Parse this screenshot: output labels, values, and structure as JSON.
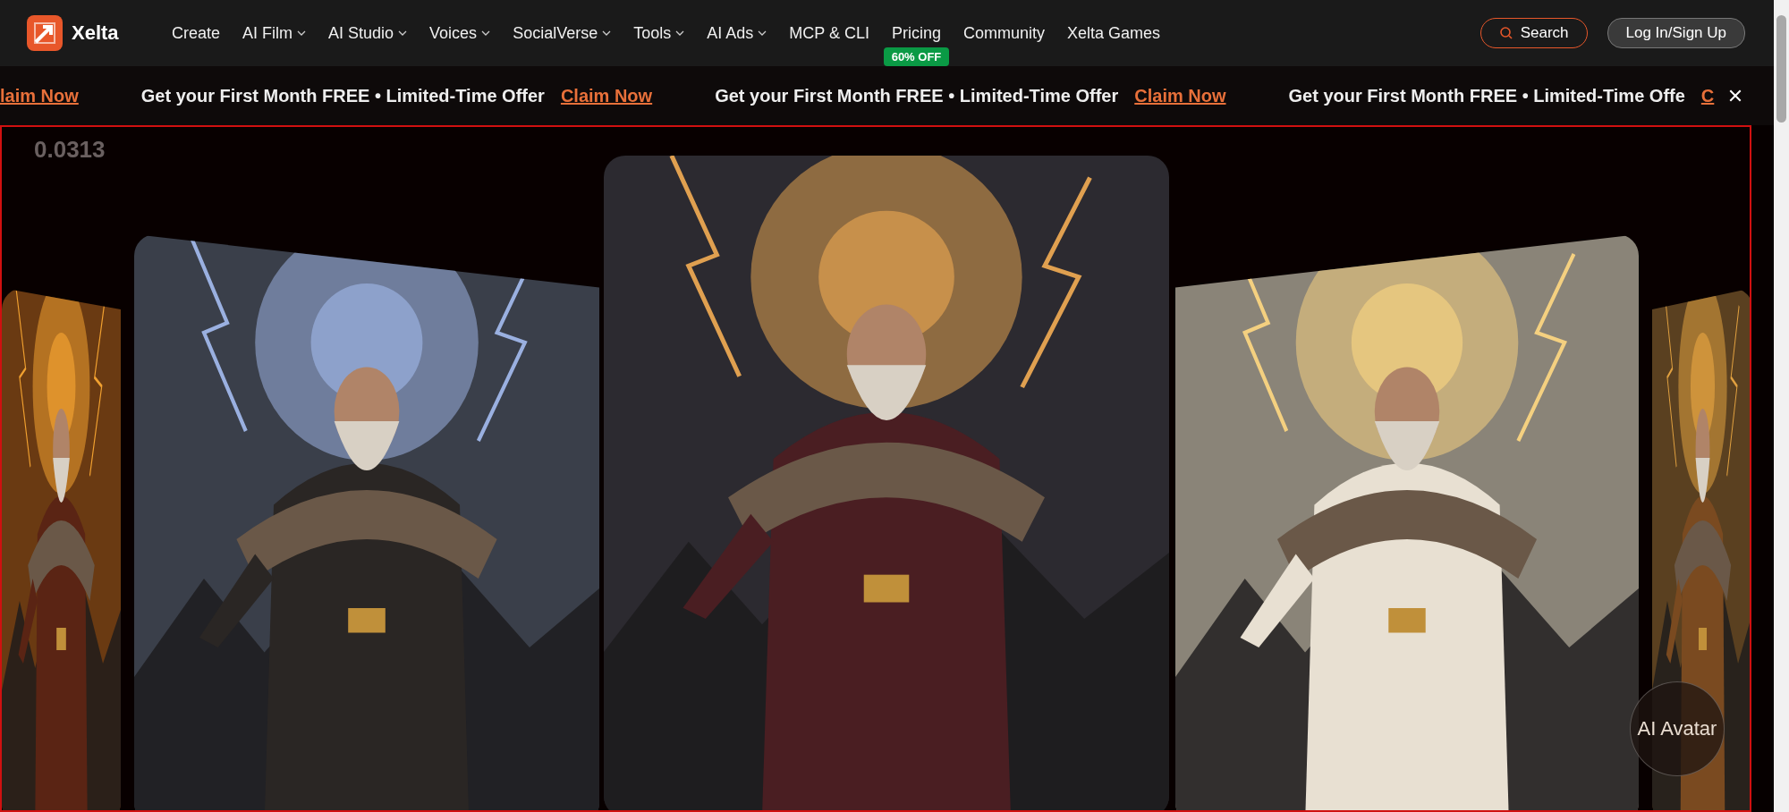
{
  "brand": {
    "name": "Xelta"
  },
  "nav": [
    {
      "label": "Create",
      "dropdown": false
    },
    {
      "label": "AI Film",
      "dropdown": true
    },
    {
      "label": "AI Studio",
      "dropdown": true
    },
    {
      "label": "Voices",
      "dropdown": true
    },
    {
      "label": "SocialVerse",
      "dropdown": true
    },
    {
      "label": "Tools",
      "dropdown": true
    },
    {
      "label": "AI Ads",
      "dropdown": true
    },
    {
      "label": "MCP & CLI",
      "dropdown": false
    },
    {
      "label": "Pricing",
      "dropdown": false,
      "badge": "60% OFF"
    },
    {
      "label": "Community",
      "dropdown": false
    },
    {
      "label": "Xelta Games",
      "dropdown": false
    }
  ],
  "search_button": "Search",
  "login_button": "Log In/Sign Up",
  "banner": [
    {
      "kind": "link",
      "text": "laim Now"
    },
    {
      "kind": "message",
      "text": "Get your First Month FREE • Limited-Time Offer"
    },
    {
      "kind": "link",
      "text": "Claim Now"
    },
    {
      "kind": "message",
      "text": "Get your First Month FREE • Limited-Time Offer"
    },
    {
      "kind": "link",
      "text": "Claim Now"
    },
    {
      "kind": "message",
      "text": "Get your First Month FREE • Limited-Time Offe"
    },
    {
      "kind": "link",
      "text": "C"
    }
  ],
  "hero": {
    "counter": "0.0313",
    "avatar_button": "AI Avatar"
  }
}
